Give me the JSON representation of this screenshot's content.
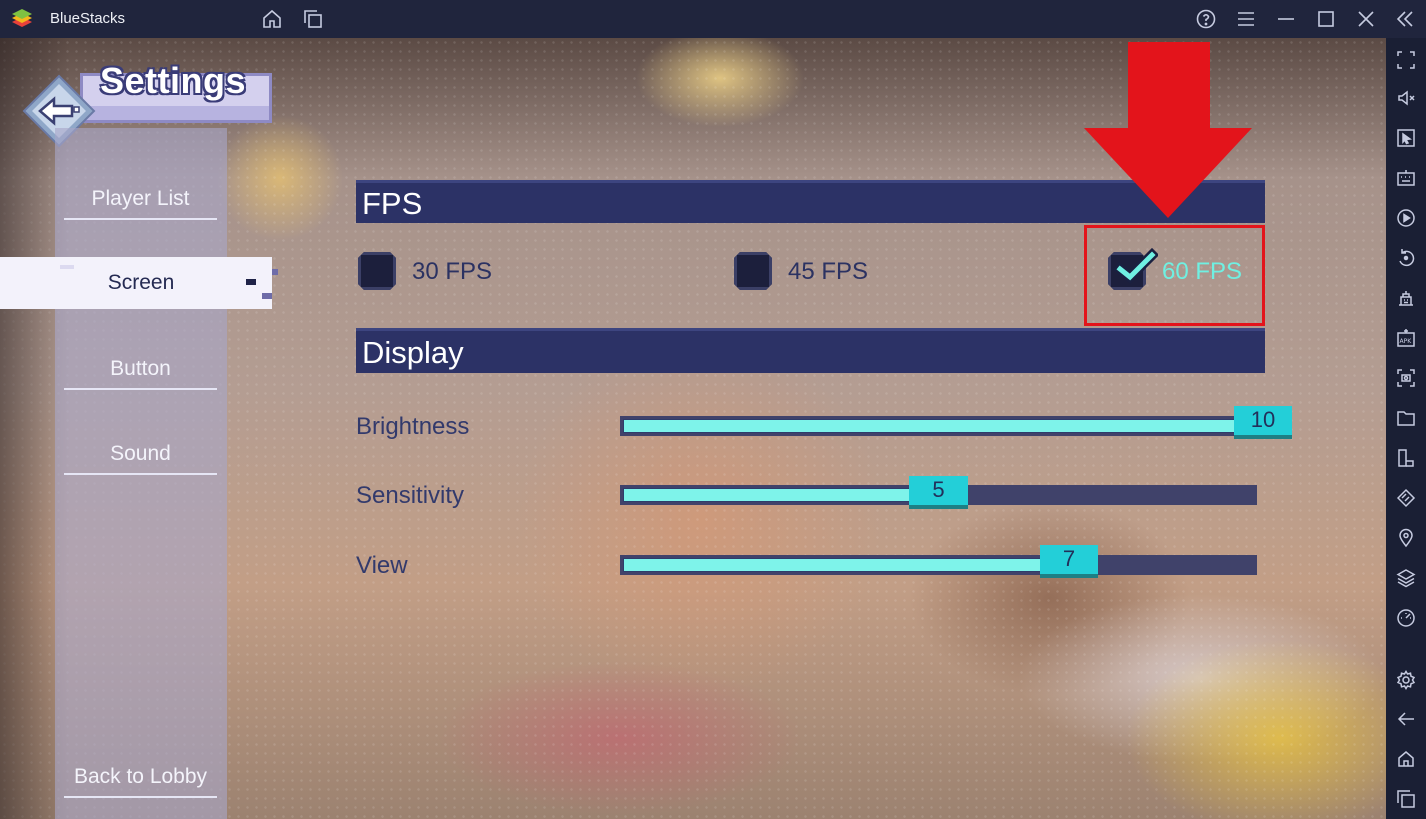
{
  "window": {
    "title": "BlueStacks",
    "icons": [
      "bluestacks-logo",
      "home-icon",
      "multi-instance-icon",
      "help-icon",
      "menu-icon",
      "minimize-icon",
      "maximize-icon",
      "close-icon",
      "collapse-sidebar-icon"
    ]
  },
  "sidebar": {
    "icons": [
      "fullscreen-icon",
      "volume-icon",
      "pointer-icon",
      "keyboard-icon",
      "record-icon",
      "rotate-icon",
      "macro-icon",
      "install-apk-icon",
      "screenshot-icon",
      "folder-icon",
      "multi-window-icon",
      "eco-mode-icon",
      "location-icon",
      "layers-icon",
      "performance-icon",
      "settings-icon",
      "back-icon",
      "home-icon",
      "recent-apps-icon"
    ]
  },
  "game": {
    "settings_title": "Settings",
    "nav": {
      "items": [
        {
          "label": "Player List",
          "active": false
        },
        {
          "label": "Screen",
          "active": true
        },
        {
          "label": "Button",
          "active": false
        },
        {
          "label": "Sound",
          "active": false
        }
      ],
      "back_label": "Back to Lobby"
    },
    "fps": {
      "header": "FPS",
      "options": [
        {
          "label": "30 FPS",
          "checked": false
        },
        {
          "label": "45 FPS",
          "checked": false
        },
        {
          "label": "60 FPS",
          "checked": true
        }
      ]
    },
    "display": {
      "header": "Display",
      "sliders": [
        {
          "label": "Brightness",
          "value": "10",
          "level": 10,
          "max": 10
        },
        {
          "label": "Sensitivity",
          "value": "5",
          "level": 5,
          "max": 10
        },
        {
          "label": "View",
          "value": "7",
          "level": 7,
          "max": 10
        }
      ]
    }
  },
  "colors": {
    "accent": "#7ef3ea",
    "header_bg": "#2c3266",
    "highlight": "#e3141b"
  }
}
